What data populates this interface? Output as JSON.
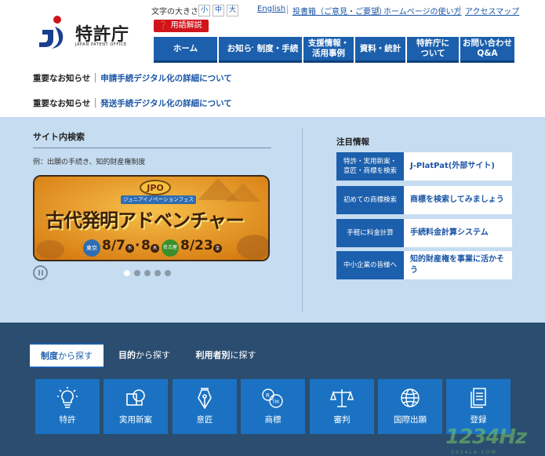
{
  "logo": {
    "name": "特許庁",
    "en": "JAPAN PATENT OFFICE"
  },
  "utility": {
    "font_size_label": "文字の大きさ",
    "font_sizes": [
      "小",
      "中",
      "大"
    ],
    "links": [
      "English",
      "投書箱（ご意見・ご要望）",
      "ホームページの使い方",
      "アクセスマップ"
    ],
    "glossary": "用語解説"
  },
  "nav": [
    {
      "label": "ホーム"
    },
    {
      "label": "お知らせ"
    },
    {
      "label": "制度・手続"
    },
    {
      "label1": "支援情報・",
      "label2": "活用事例"
    },
    {
      "label": "資料・統計"
    },
    {
      "label1": "特許庁に",
      "label2": "ついて"
    },
    {
      "label1": "お問い合わせ",
      "label2": "Q&A"
    }
  ],
  "notices": [
    {
      "label": "重要なお知らせ",
      "link": "申請手続デジタル化の詳細について"
    },
    {
      "label": "重要なお知らせ",
      "link": "発送手続デジタル化の詳細について"
    }
  ],
  "search": {
    "title": "サイト内検索",
    "example": "例：出願の手続き、知的財産権制度"
  },
  "banner": {
    "logo_text": "JPO",
    "sub": "ジュニアイノベーションフェス",
    "title": "古代発明アドベンチャー",
    "date1": "8/7",
    "day1": "水",
    "date2": "8",
    "day2": "木",
    "place1": "東京",
    "place2": "名古屋",
    "date3": "8/23",
    "day3": "金"
  },
  "attention": {
    "title": "注目情報",
    "items": [
      {
        "tag1": "特許・実用新案・",
        "tag2": "意匠・商標を検索",
        "link": "J-PlatPat(外部サイト)"
      },
      {
        "tag1": "初めての商標検索",
        "tag2": "",
        "link": "商標を検索してみましょう"
      },
      {
        "tag1": "手軽に料金計算",
        "tag2": "",
        "link": "手続料金計算システム"
      },
      {
        "tag1": "中小企業の皆様へ",
        "tag2": "",
        "link1": "知的財産権を事業に活かそ",
        "link2": "う"
      }
    ]
  },
  "tabs": [
    {
      "strong": "制度",
      "rest": "から探す"
    },
    {
      "strong": "目的",
      "rest": "から探す"
    },
    {
      "strong": "利用者別",
      "rest": "に探す"
    }
  ],
  "categories": [
    {
      "label": "特許",
      "icon": "lightbulb-icon"
    },
    {
      "label": "実用新案",
      "icon": "utility-model-icon"
    },
    {
      "label": "意匠",
      "icon": "pen-nib-icon"
    },
    {
      "label": "商標",
      "icon": "trademark-icon"
    },
    {
      "label": "審判",
      "icon": "scales-icon"
    },
    {
      "label": "国際出願",
      "icon": "globe-icon"
    },
    {
      "label": "登録",
      "icon": "document-icon"
    }
  ],
  "watermark": {
    "main": "1234Hz",
    "sub": "1234LA.COM"
  },
  "colors": {
    "brand_blue": "#1b5fad",
    "accent_red": "#d0141c",
    "light_blue": "#c6dcf1",
    "dark_navy": "#2b4d70"
  }
}
